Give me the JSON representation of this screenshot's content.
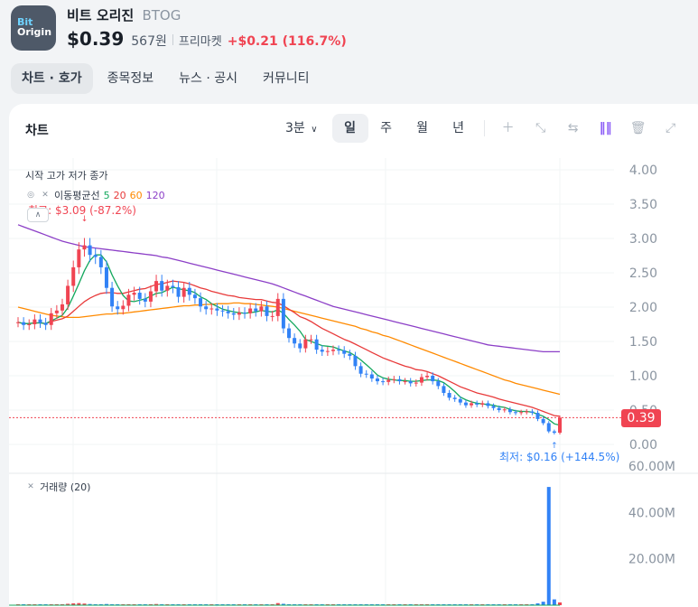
{
  "coin": {
    "logo_line1": "Bit",
    "logo_line2": "Origin",
    "name": "비트 오리진",
    "ticker": "BTOG",
    "price": "$0.39",
    "krw": "567원",
    "market": "프리마켓",
    "change": "+$0.21 (116.7%)"
  },
  "tabs": [
    "차트 · 호가",
    "종목정보",
    "뉴스 · 공시",
    "커뮤니티"
  ],
  "chart_header": {
    "title": "차트",
    "timeframe": "3분",
    "periods": [
      "일",
      "주",
      "월",
      "년"
    ],
    "tool_icons": [
      "plus-icon",
      "ruler-icon",
      "swap-icon",
      "indicator-icon",
      "trash-icon",
      "expand-icon"
    ]
  },
  "colors": {
    "up": "#f04452",
    "down": "#3182f6",
    "ma5": "#14a85e",
    "ma20": "#e83a3a",
    "ma60": "#ff8a00",
    "ma120": "#8c3fc7"
  },
  "legend": {
    "ohlc": "시작 고가 저가 종가",
    "ma_label": "이동평균선",
    "ma5": "5",
    "ma20": "20",
    "ma60": "60",
    "ma120": "120",
    "high": "최고: $3.09 (-87.2%)",
    "low": "최저: $0.16 (+144.5%)",
    "current": "0.39",
    "volume": "거래량 (20)"
  },
  "chart_data": {
    "type": "candlestick",
    "y_ticks": [
      "4.00",
      "3.50",
      "3.00",
      "2.50",
      "2.00",
      "1.50",
      "1.00",
      "0.50",
      "0.00"
    ],
    "volume_ticks": [
      "60.00M",
      "40.00M",
      "20.00M"
    ],
    "ylim": [
      0,
      4
    ],
    "volume_max": 60000000,
    "close": [
      1.78,
      1.74,
      1.75,
      1.82,
      1.77,
      1.74,
      1.91,
      1.95,
      2.04,
      2.31,
      2.58,
      2.84,
      2.9,
      2.76,
      2.73,
      2.58,
      2.28,
      2.01,
      1.97,
      2.02,
      2.18,
      2.21,
      2.12,
      2.08,
      2.23,
      2.38,
      2.24,
      2.31,
      2.29,
      2.15,
      2.28,
      2.18,
      2.13,
      2.01,
      1.97,
      1.98,
      1.95,
      1.94,
      1.91,
      1.89,
      1.92,
      1.91,
      1.98,
      1.94,
      2.01,
      1.87,
      1.87,
      2.12,
      1.69,
      1.55,
      1.47,
      1.4,
      1.53,
      1.53,
      1.38,
      1.35,
      1.36,
      1.38,
      1.37,
      1.32,
      1.29,
      1.14,
      1.03,
      1.02,
      0.96,
      0.92,
      0.91,
      0.94,
      0.95,
      0.92,
      0.92,
      0.89,
      0.9,
      0.98,
      1.0,
      0.92,
      0.85,
      0.75,
      0.68,
      0.66,
      0.61,
      0.57,
      0.6,
      0.58,
      0.6,
      0.56,
      0.53,
      0.5,
      0.51,
      0.47,
      0.46,
      0.47,
      0.48,
      0.46,
      0.37,
      0.31,
      0.19,
      0.17,
      0.39
    ],
    "ma5": [
      1.78,
      1.76,
      1.76,
      1.77,
      1.77,
      1.76,
      1.8,
      1.84,
      1.88,
      1.99,
      2.16,
      2.34,
      2.53,
      2.68,
      2.76,
      2.76,
      2.66,
      2.47,
      2.31,
      2.17,
      2.09,
      2.08,
      2.1,
      2.12,
      2.16,
      2.2,
      2.21,
      2.25,
      2.29,
      2.27,
      2.25,
      2.24,
      2.21,
      2.15,
      2.11,
      2.05,
      2.01,
      1.97,
      1.95,
      1.93,
      1.92,
      1.91,
      1.92,
      1.93,
      1.95,
      1.94,
      1.93,
      1.96,
      1.91,
      1.82,
      1.74,
      1.65,
      1.53,
      1.5,
      1.47,
      1.44,
      1.43,
      1.42,
      1.39,
      1.36,
      1.34,
      1.29,
      1.23,
      1.16,
      1.09,
      1.01,
      0.97,
      0.95,
      0.94,
      0.93,
      0.93,
      0.92,
      0.92,
      0.93,
      0.94,
      0.94,
      0.93,
      0.9,
      0.84,
      0.77,
      0.69,
      0.65,
      0.62,
      0.6,
      0.59,
      0.58,
      0.57,
      0.55,
      0.54,
      0.51,
      0.49,
      0.48,
      0.48,
      0.47,
      0.44,
      0.41,
      0.36,
      0.3,
      0.28
    ],
    "ma20": [
      1.78,
      1.76,
      1.76,
      1.77,
      1.77,
      1.76,
      1.79,
      1.81,
      1.83,
      1.87,
      1.94,
      2.01,
      2.08,
      2.13,
      2.17,
      2.2,
      2.21,
      2.21,
      2.2,
      2.2,
      2.22,
      2.24,
      2.26,
      2.27,
      2.3,
      2.33,
      2.34,
      2.36,
      2.38,
      2.37,
      2.36,
      2.34,
      2.31,
      2.28,
      2.26,
      2.23,
      2.21,
      2.19,
      2.17,
      2.16,
      2.14,
      2.13,
      2.12,
      2.11,
      2.11,
      2.09,
      2.07,
      2.06,
      2.02,
      1.97,
      1.92,
      1.86,
      1.83,
      1.79,
      1.74,
      1.69,
      1.65,
      1.61,
      1.57,
      1.53,
      1.5,
      1.46,
      1.42,
      1.38,
      1.34,
      1.3,
      1.26,
      1.23,
      1.2,
      1.17,
      1.14,
      1.12,
      1.09,
      1.08,
      1.06,
      1.03,
      1.0,
      0.96,
      0.92,
      0.88,
      0.84,
      0.81,
      0.78,
      0.75,
      0.73,
      0.71,
      0.69,
      0.66,
      0.64,
      0.62,
      0.6,
      0.58,
      0.56,
      0.54,
      0.51,
      0.48,
      0.45,
      0.42,
      0.41
    ],
    "ma60": [
      2.0,
      1.98,
      1.96,
      1.94,
      1.92,
      1.9,
      1.88,
      1.87,
      1.86,
      1.85,
      1.85,
      1.85,
      1.86,
      1.87,
      1.88,
      1.89,
      1.9,
      1.9,
      1.91,
      1.91,
      1.92,
      1.93,
      1.94,
      1.95,
      1.96,
      1.97,
      1.98,
      1.99,
      2.0,
      2.01,
      2.02,
      2.02,
      2.03,
      2.03,
      2.04,
      2.04,
      2.05,
      2.05,
      2.05,
      2.06,
      2.06,
      2.05,
      2.05,
      2.04,
      2.03,
      2.02,
      2.01,
      2.0,
      1.98,
      1.96,
      1.94,
      1.92,
      1.9,
      1.88,
      1.86,
      1.84,
      1.82,
      1.8,
      1.78,
      1.76,
      1.74,
      1.72,
      1.69,
      1.67,
      1.64,
      1.62,
      1.59,
      1.57,
      1.54,
      1.51,
      1.48,
      1.45,
      1.42,
      1.39,
      1.36,
      1.33,
      1.3,
      1.27,
      1.24,
      1.21,
      1.18,
      1.15,
      1.12,
      1.09,
      1.06,
      1.03,
      1.0,
      0.97,
      0.94,
      0.92,
      0.89,
      0.87,
      0.85,
      0.83,
      0.81,
      0.79,
      0.77,
      0.75,
      0.73
    ],
    "ma120": [
      3.2,
      3.17,
      3.14,
      3.11,
      3.08,
      3.05,
      3.02,
      2.99,
      2.96,
      2.94,
      2.92,
      2.9,
      2.88,
      2.87,
      2.86,
      2.85,
      2.84,
      2.83,
      2.82,
      2.81,
      2.8,
      2.79,
      2.78,
      2.77,
      2.76,
      2.75,
      2.73,
      2.72,
      2.7,
      2.68,
      2.66,
      2.64,
      2.62,
      2.6,
      2.58,
      2.56,
      2.54,
      2.52,
      2.5,
      2.48,
      2.46,
      2.44,
      2.42,
      2.4,
      2.38,
      2.36,
      2.34,
      2.31,
      2.28,
      2.25,
      2.22,
      2.19,
      2.16,
      2.13,
      2.1,
      2.07,
      2.04,
      2.01,
      1.99,
      1.97,
      1.95,
      1.93,
      1.91,
      1.89,
      1.87,
      1.85,
      1.83,
      1.81,
      1.79,
      1.77,
      1.75,
      1.73,
      1.71,
      1.69,
      1.67,
      1.65,
      1.63,
      1.61,
      1.59,
      1.57,
      1.55,
      1.53,
      1.51,
      1.49,
      1.47,
      1.45,
      1.44,
      1.43,
      1.42,
      1.41,
      1.4,
      1.39,
      1.38,
      1.37,
      1.36,
      1.35,
      1.35,
      1.35,
      1.35
    ],
    "volume_millions": [
      0.3,
      0.2,
      0.2,
      0.3,
      0.2,
      0.2,
      0.4,
      0.3,
      0.4,
      0.6,
      0.8,
      0.9,
      0.7,
      0.5,
      0.4,
      0.4,
      0.5,
      0.4,
      0.3,
      0.3,
      0.4,
      0.3,
      0.3,
      0.3,
      0.4,
      0.5,
      0.4,
      0.3,
      0.3,
      0.3,
      0.3,
      0.3,
      0.3,
      0.3,
      0.2,
      0.2,
      0.2,
      0.2,
      0.2,
      0.2,
      0.2,
      0.2,
      0.2,
      0.2,
      0.3,
      0.3,
      0.3,
      0.9,
      0.6,
      0.4,
      0.3,
      0.3,
      0.3,
      0.2,
      0.2,
      0.2,
      0.2,
      0.2,
      0.2,
      0.2,
      0.2,
      0.3,
      0.3,
      0.3,
      0.2,
      0.2,
      0.2,
      0.2,
      0.2,
      0.2,
      0.2,
      0.2,
      0.2,
      0.3,
      0.3,
      0.2,
      0.2,
      0.2,
      0.2,
      0.2,
      0.2,
      0.2,
      0.2,
      0.2,
      0.2,
      0.2,
      0.2,
      0.2,
      0.2,
      0.2,
      0.2,
      0.2,
      0.2,
      0.4,
      0.8,
      1.5,
      51.0,
      2.5,
      1.2
    ]
  }
}
